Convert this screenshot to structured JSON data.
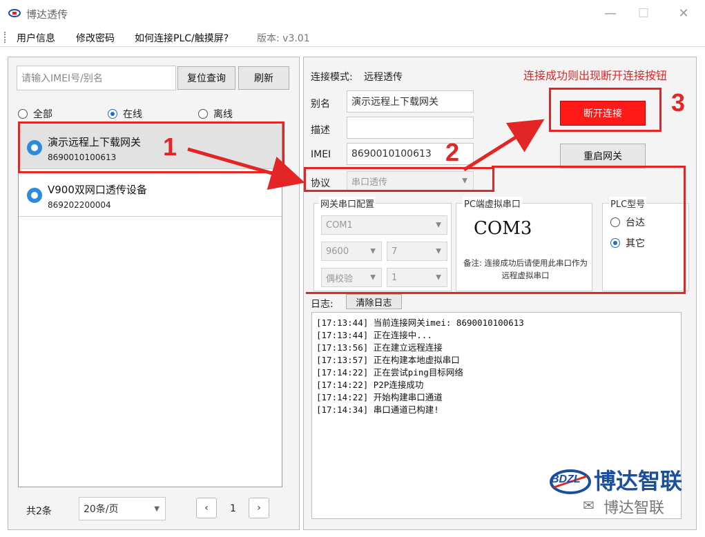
{
  "window": {
    "title": "博达透传",
    "minimize": "—",
    "maximize": "☐",
    "close": "✕"
  },
  "menu": {
    "items": [
      "用户信息",
      "修改密码",
      "如何连接PLC/触摸屏?"
    ],
    "version": "版本: v3.01"
  },
  "search": {
    "placeholder": "请输入IMEI号/别名",
    "reset_label": "复位查询",
    "refresh_label": "刷新"
  },
  "filter": {
    "all": "全部",
    "online": "在线",
    "offline": "离线",
    "selected": "online"
  },
  "devices": [
    {
      "name": "演示远程上下载网关",
      "imei": "8690010100613"
    },
    {
      "name": "V900双网口透传设备",
      "imei": "869202200004"
    }
  ],
  "pager": {
    "total": "共2条",
    "per_page": "20条/页",
    "prev": "‹",
    "page": "1",
    "next": "›"
  },
  "connection": {
    "mode_label": "连接模式:",
    "mode_value": "远程透传",
    "alias_label": "别名",
    "alias_value": "演示远程上下载网关",
    "desc_label": "描述",
    "desc_value": "",
    "imei_label": "IMEI",
    "imei_value": "8690010100613",
    "protocol_label": "协议",
    "protocol_value": "串口透传",
    "disconnect_label": "断开连接",
    "restart_label": "重启网关"
  },
  "gateway_serial": {
    "title": "网关串口配置",
    "port": "COM1",
    "baud": "9600",
    "databits": "7",
    "parity": "偶校验",
    "stopbits": "1"
  },
  "pc_serial": {
    "title": "PC端虚拟串口",
    "port": "COM3",
    "note": "备注: 连接成功后请使用此串口作为远程虚拟串口"
  },
  "plc": {
    "title": "PLC型号",
    "options": [
      "台达",
      "其它"
    ],
    "selected": "其它"
  },
  "log": {
    "label": "日志:",
    "clear_label": "清除日志",
    "lines": [
      "[17:13:44] 当前连接网关imei: 8690010100613",
      "[17:13:44] 正在连接中...",
      "[17:13:56] 正在建立远程连接",
      "[17:13:57] 正在构建本地虚拟串口",
      "[17:14:22] 正在尝试ping目标网络",
      "[17:14:22] P2P连接成功",
      "[17:14:22] 开始构建串口通道",
      "[17:14:34] 串口通道已构建!"
    ]
  },
  "annotations": {
    "num1": "1",
    "num2": "2",
    "num3": "3",
    "tip": "连接成功则出现断开连接按钮"
  },
  "brand": {
    "logo_text": "BDZL",
    "name": "博达智联",
    "wechat": "博达智联"
  },
  "colors": {
    "accent_red": "#e42525",
    "disconnect_bg": "#ff1a1a",
    "radio_blue": "#1e6fd0",
    "brand_blue": "#1a4fa0"
  }
}
